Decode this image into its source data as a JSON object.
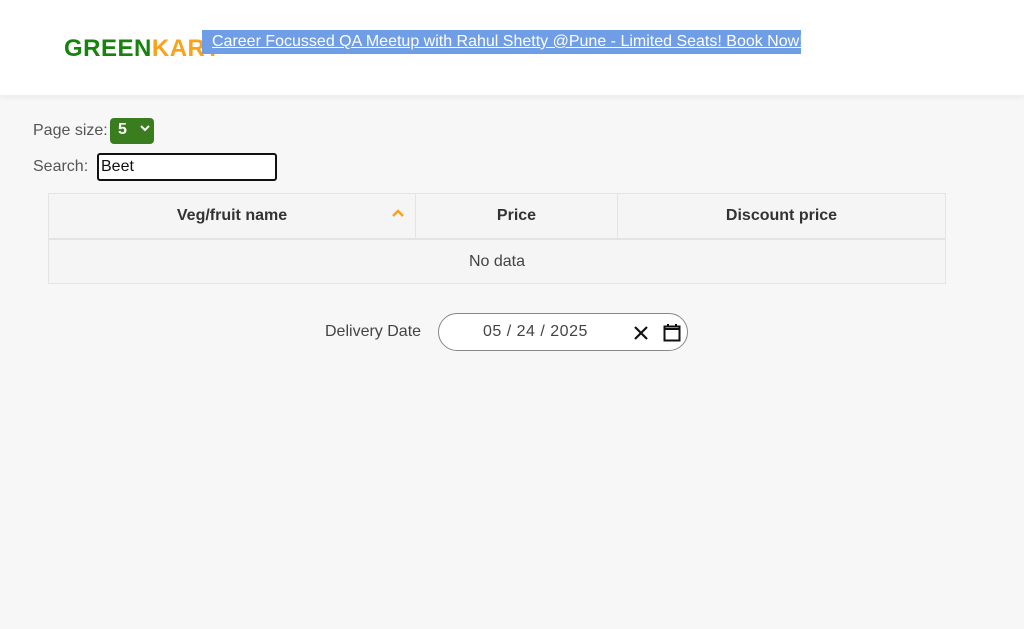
{
  "header": {
    "logo_green": "GREEN",
    "logo_kart": "KART",
    "banner_text": "Career Focussed QA Meetup with Rahul Shetty @Pune - Limited Seats! Book Now!"
  },
  "controls": {
    "page_size_label": "Page size:",
    "page_size_value": "5",
    "search_label": "Search:",
    "search_value": "Beet"
  },
  "table": {
    "columns": [
      "Veg/fruit name",
      "Price",
      "Discount price"
    ],
    "empty_text": "No data",
    "sort_column": "Veg/fruit name",
    "sort_direction": "ascending"
  },
  "delivery": {
    "label": "Delivery Date",
    "date_value": "05 / 24 / 2025"
  },
  "colors": {
    "brand_green": "#18820f",
    "brand_orange": "#f9a21a",
    "banner_bg": "#6f9ee6",
    "select_bg": "#3a7d1e"
  },
  "icons": [
    "sort-ascending-icon",
    "chevron-down-icon",
    "clear-icon",
    "calendar-icon"
  ]
}
